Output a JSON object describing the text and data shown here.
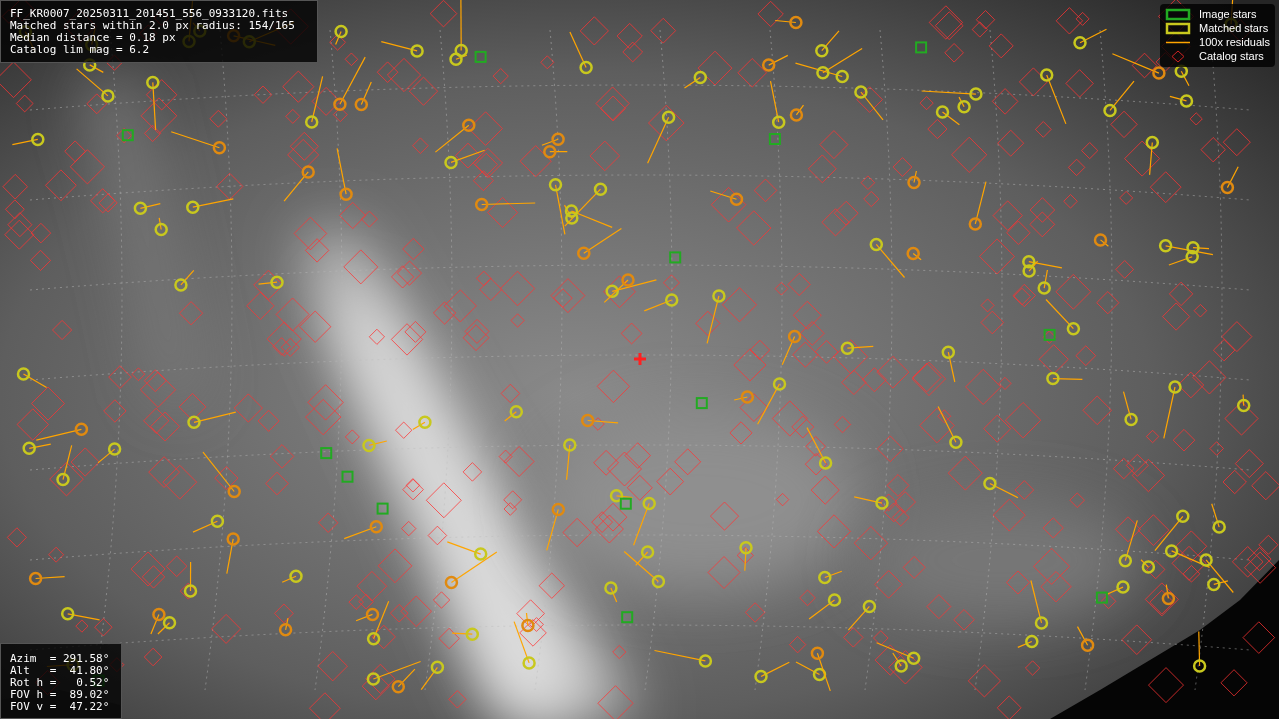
{
  "info_box": {
    "lines": [
      "FF_KR0007_20250311_201451_556_0933120.fits",
      "Matched stars within 2.0 px radius: 154/165",
      "Median distance = 0.18 px",
      "Catalog lim mag = 6.2"
    ]
  },
  "legend": [
    {
      "label": "Image stars"
    },
    {
      "kind": "matched",
      "label": "Matched stars"
    },
    {
      "kind": "residual",
      "label": "100x residuals"
    },
    {
      "kind": "catalog",
      "label": "Catalog stars"
    }
  ],
  "pointing_box": {
    "lines": [
      "Azim  = 291.58°",
      "Alt   =  41.80°",
      "Rot h =   0.52°",
      "FOV h =  89.02°",
      "FOV v =  47.22°"
    ]
  }
}
